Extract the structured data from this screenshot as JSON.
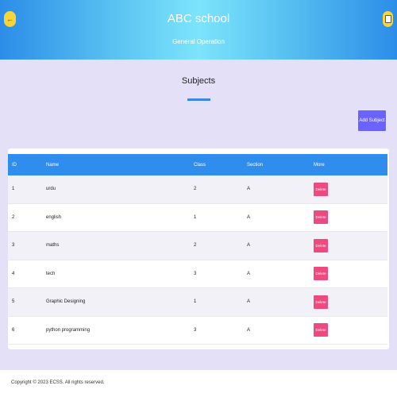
{
  "header": {
    "title": "ABC school",
    "subtitle": "General Operation",
    "back_icon": "arrow-left-icon",
    "right_icon": "document-icon",
    "accent_color": "#f5d53a"
  },
  "page": {
    "heading": "Subjects",
    "add_button_label": "Add Subject"
  },
  "table": {
    "columns": [
      "ID",
      "Name",
      "Class",
      "Section",
      "More"
    ],
    "delete_label": "Delete",
    "rows": [
      {
        "id": "1",
        "name": "urdu",
        "class": "2",
        "section": "A"
      },
      {
        "id": "2",
        "name": "english",
        "class": "1",
        "section": "A"
      },
      {
        "id": "3",
        "name": "maths",
        "class": "2",
        "section": "A"
      },
      {
        "id": "4",
        "name": "tech",
        "class": "3",
        "section": "A"
      },
      {
        "id": "5",
        "name": "Graphic Designing",
        "class": "1",
        "section": "A"
      },
      {
        "id": "6",
        "name": "python programming",
        "class": "3",
        "section": "A"
      }
    ]
  },
  "footer": {
    "copyright": "Copyright © 2023 ECSS. All rights reserved."
  }
}
